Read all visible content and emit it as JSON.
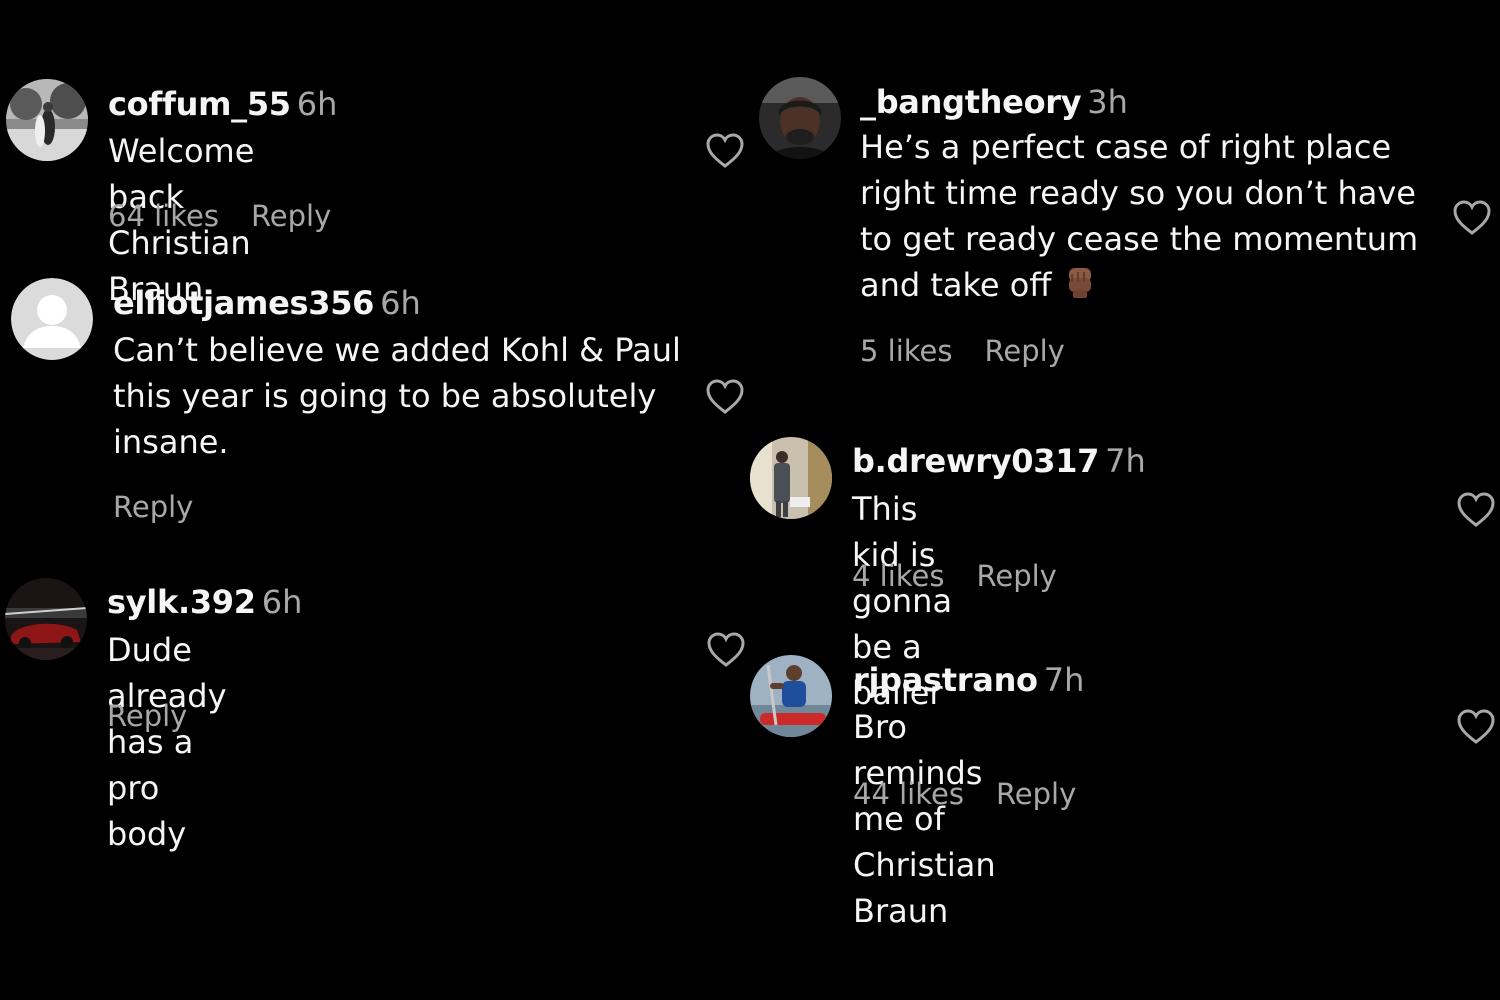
{
  "colors": {
    "background": "#000000",
    "text": "#f5f5f5",
    "muted": "#a8a8a8"
  },
  "comments": [
    {
      "username": "coffum_55",
      "time": "6h",
      "text": "Welcome back Christian Braun",
      "likes": "64 likes",
      "reply": "Reply"
    },
    {
      "username": "elliotjames356",
      "time": "6h",
      "text": "Can’t believe we added Kohl & Paul\nthis year is going to be absolutely\ninsane.",
      "likes": "",
      "reply": "Reply"
    },
    {
      "username": "sylk.392",
      "time": "6h",
      "text": "Dude already has a pro body",
      "likes": "",
      "reply": "Reply"
    },
    {
      "username": "_bangtheory",
      "time": "3h",
      "text": "He’s a perfect case of right place\nright time ready so you don’t have\nto get ready cease the momentum\nand take off",
      "emoji": "raised-fist-emoji",
      "likes": "5 likes",
      "reply": "Reply"
    },
    {
      "username": "b.drewry0317",
      "time": "7h",
      "text": "This kid is gonna be a baller",
      "likes": "4 likes",
      "reply": "Reply"
    },
    {
      "username": "rjpastrano",
      "time": "7h",
      "text": "Bro reminds me of Christian Braun",
      "likes": "44 likes",
      "reply": "Reply"
    }
  ]
}
